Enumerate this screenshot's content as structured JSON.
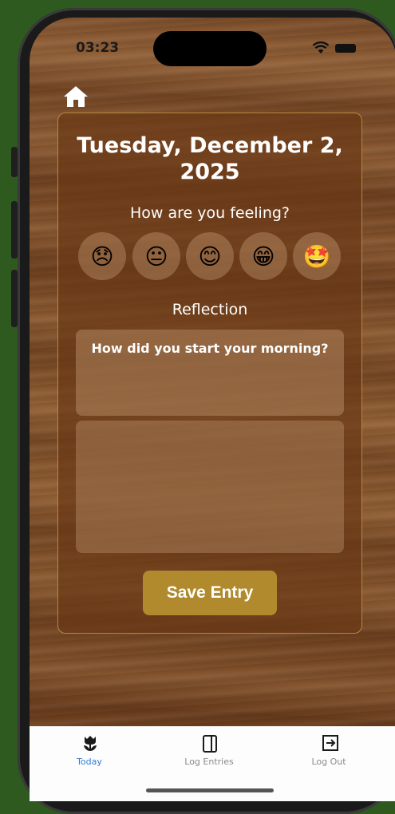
{
  "status_bar": {
    "time": "03:23"
  },
  "entry": {
    "date": "Tuesday, December 2, 2025",
    "feeling_prompt": "How are you feeling?",
    "moods": [
      {
        "emoji": "😞",
        "name": "sad"
      },
      {
        "emoji": "😐",
        "name": "neutral"
      },
      {
        "emoji": "😊",
        "name": "happy"
      },
      {
        "emoji": "😁",
        "name": "very-happy"
      },
      {
        "emoji": "🤩",
        "name": "excited"
      }
    ],
    "reflection_label": "Reflection",
    "reflection_question": "How did you start your morning?",
    "reflection_answer": "",
    "save_label": "Save Entry"
  },
  "tabs": [
    {
      "label": "Today",
      "icon": "tulip-icon",
      "active": true
    },
    {
      "label": "Log Entries",
      "icon": "book-icon",
      "active": false
    },
    {
      "label": "Log Out",
      "icon": "logout-icon",
      "active": false
    }
  ],
  "colors": {
    "accent": "#b08a2c",
    "active_tab": "#2f7dd1"
  }
}
